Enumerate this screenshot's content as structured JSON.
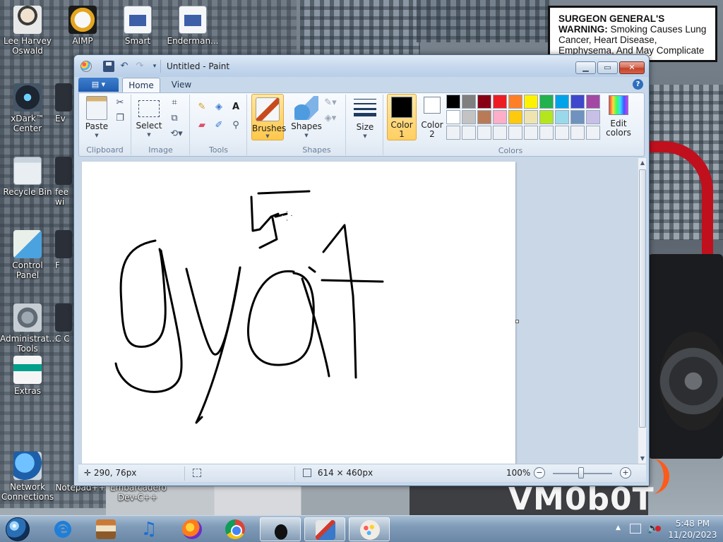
{
  "warning": {
    "head": "SURGEON GENERAL'S WARNING:",
    "body": "Smoking Causes Lung Cancer, Heart Disease, Emphysema, And May Complicate Pregnancy."
  },
  "desktop": {
    "icons": [
      {
        "label": "Lee Harvey Oswald",
        "icon": "person-icon"
      },
      {
        "label": "AIMP",
        "icon": "aimp-icon"
      },
      {
        "label": "Smart",
        "icon": "document-icon"
      },
      {
        "label": "Enderman...",
        "icon": "document-icon"
      },
      {
        "label": "xDark™ Center",
        "icon": "xdark-icon"
      },
      {
        "label": "Ev",
        "icon": "app-icon"
      },
      {
        "label": "Recycle Bin",
        "icon": "recycle-bin-icon"
      },
      {
        "label": "fee wi",
        "icon": "app-icon"
      },
      {
        "label": "Control Panel",
        "icon": "control-panel-icon"
      },
      {
        "label": "F",
        "icon": "app-icon"
      },
      {
        "label": "Administrat... Tools",
        "icon": "admin-tools-icon"
      },
      {
        "label": "C C",
        "icon": "app-icon"
      },
      {
        "label": "Extras",
        "icon": "extras-icon"
      },
      {
        "label": "Network Connections",
        "icon": "network-icon"
      },
      {
        "label": "Notepad++",
        "icon": "notepad-icon"
      },
      {
        "label": "Embarcadero Dev-C++",
        "icon": "devcpp-icon"
      }
    ],
    "wallpaper_text": "VM0b0T"
  },
  "window": {
    "title": "Untitled - Paint",
    "controls": {
      "minimize": "▭",
      "maximize": "▭",
      "close": "✕"
    }
  },
  "ribbon": {
    "tabs": {
      "file": "▤ ▾",
      "home": "Home",
      "view": "View"
    },
    "groups": {
      "clipboard": {
        "label": "Clipboard",
        "paste": "Paste"
      },
      "image": {
        "label": "Image",
        "select": "Select"
      },
      "tools": {
        "label": "Tools",
        "text_tool": "A"
      },
      "brushes": {
        "label": "Brushes"
      },
      "shapes": {
        "label": "Shapes",
        "button": "Shapes"
      },
      "size": {
        "label": "Size"
      },
      "colors": {
        "label": "Colors",
        "color1": "Color\n1",
        "color2": "Color\n2",
        "edit": "Edit\ncolors"
      }
    },
    "color1": "#000000",
    "color2": "#ffffff",
    "palette": [
      "#000000",
      "#7f7f7f",
      "#880015",
      "#ed1c24",
      "#ff7f27",
      "#fff200",
      "#22b14c",
      "#00a2e8",
      "#3f48cc",
      "#a349a4",
      "#ffffff",
      "#c3c3c3",
      "#b97a57",
      "#ffaec9",
      "#ffc90e",
      "#efe4b0",
      "#b5e61d",
      "#99d9ea",
      "#7092be",
      "#c8bfe7",
      "#eef2f6",
      "#eef2f6",
      "#eef2f6",
      "#eef2f6",
      "#eef2f6",
      "#eef2f6",
      "#eef2f6",
      "#eef2f6",
      "#eef2f6",
      "#eef2f6"
    ]
  },
  "status": {
    "cursor_pos": "290, 76px",
    "canvas_size": "614 × 460px",
    "zoom": "100%"
  },
  "taskbar": {
    "apps": [
      "Internet Explorer",
      "Library",
      "Music",
      "Firefox",
      "Chrome",
      "Hat app",
      "Tools",
      "Paint"
    ],
    "active": "Paint",
    "time": "5:48 PM",
    "date": "11/20/2023"
  }
}
